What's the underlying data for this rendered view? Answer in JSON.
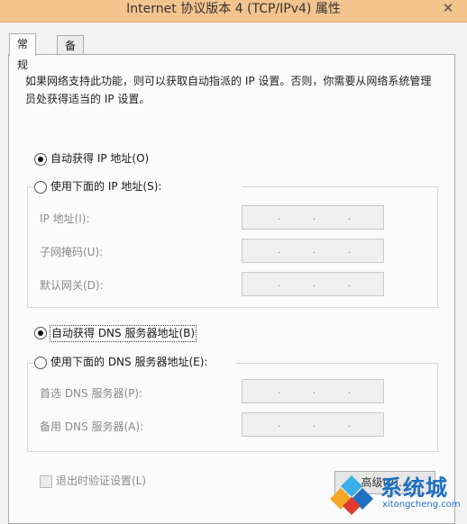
{
  "window": {
    "title": "Internet 协议版本 4 (TCP/IPv4) 属性",
    "close_glyph": "✕"
  },
  "tabs": [
    {
      "label": "常规",
      "active": true
    },
    {
      "label": "备用配置",
      "active": false
    }
  ],
  "description": "如果网络支持此功能，则可以获取自动指派的 IP 设置。否则，你需要从网络系统管理员处获得适当的 IP 设置。",
  "ip": {
    "auto_label": "自动获得 IP 地址(O)",
    "auto_checked": true,
    "manual_label": "使用下面的 IP 地址(S):",
    "manual_checked": false,
    "fields": [
      {
        "label": "IP 地址(I):",
        "value": ""
      },
      {
        "label": "子网掩码(U):",
        "value": ""
      },
      {
        "label": "默认网关(D):",
        "value": ""
      }
    ]
  },
  "dns": {
    "auto_label": "自动获得 DNS 服务器地址(B)",
    "auto_checked": true,
    "manual_label": "使用下面的 DNS 服务器地址(E):",
    "manual_checked": false,
    "fields": [
      {
        "label": "首选 DNS 服务器(P):",
        "value": ""
      },
      {
        "label": "备用 DNS 服务器(A):",
        "value": ""
      }
    ]
  },
  "validate_on_exit": {
    "label": "退出时验证设置(L)",
    "checked": false,
    "enabled": false
  },
  "advanced_button": "高级(V)...",
  "ip_separator": ".",
  "watermark": {
    "text": "系统城",
    "url": "xitongcheng.com",
    "colors": [
      "#1e6fc2",
      "#3ab0e6",
      "#e03a2f",
      "#f5a623"
    ]
  }
}
